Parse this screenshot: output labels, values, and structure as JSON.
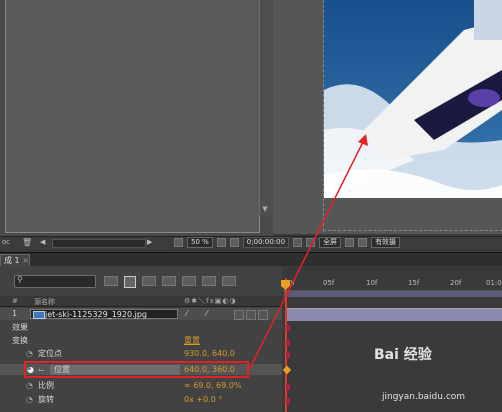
{
  "project": {
    "bottom_bar": {
      "icons": [
        "comp-icon",
        "trash-icon",
        "scroll-left-icon",
        "scroll-right-icon"
      ]
    }
  },
  "viewer": {
    "zoom": "50 %",
    "timecode": "0;00:00:00",
    "view_mode": "全屏",
    "extra_label": "有效摄"
  },
  "timeline": {
    "tab_label": "成 1",
    "header": {
      "num": "#",
      "source_name": "源名称"
    },
    "layer": {
      "index": "1",
      "name": "jet-ski-1125329_1920.jpg"
    },
    "properties": [
      {
        "label": "效果",
        "value": ""
      },
      {
        "label": "变换",
        "value": "重置"
      },
      {
        "label": "定位点",
        "value": "930.0, 640.0"
      },
      {
        "label": "位置",
        "value": "640.0, 360.0"
      },
      {
        "label": "比例",
        "value": "∞ 69.0, 69.0%"
      },
      {
        "label": "旋转",
        "value": "0x +0.0 °"
      }
    ],
    "ruler_ticks": [
      "0f",
      "05f",
      "10f",
      "15f",
      "20f",
      "01:0"
    ]
  },
  "watermark": {
    "brand": "Bai 经验",
    "url": "jingyan.baidu.com"
  },
  "colors": {
    "highlight_box": "#e02424",
    "value_orange": "#d89a2a",
    "playhead": "#e03a2a"
  }
}
